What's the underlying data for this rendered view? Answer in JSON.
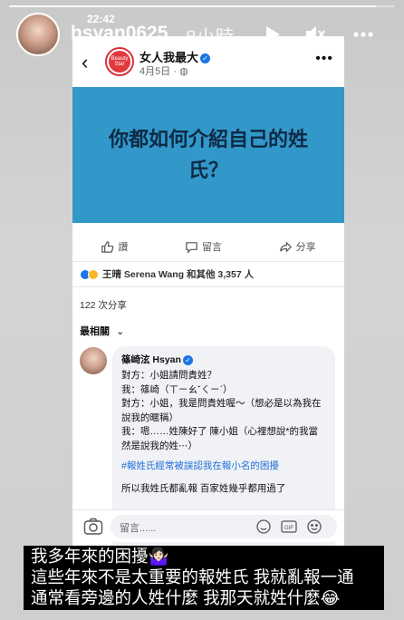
{
  "story": {
    "username": "hsyan0625",
    "time": "8小時",
    "progress": 0.95,
    "icons": [
      "play-icon",
      "mute-icon",
      "more-icon"
    ]
  },
  "phone_status": {
    "time": "22:42"
  },
  "post": {
    "page_name": "女人我最大",
    "page_logo_text": "Beauty Star",
    "date": "4月5日 · ",
    "banner_text": "你都如何介紹自己的姓氏？",
    "actions": {
      "like": "讚",
      "comment": "留言",
      "share": "分享"
    },
    "reactions_text": "王晴 Serena Wang 和其他 3,357 人",
    "shares_text": "122 次分享",
    "sort_label": "最相關",
    "comment": {
      "author": "篠崎泫 Hsyan",
      "lines": [
        "對方：小姐請問貴姓？",
        "我：篠崎（ㄒㄧㄠˇㄑㄧˊ）",
        "對方：小姐，我是問貴姓喔～（想必是以為我在說我的暱稱）",
        "我：嗯……姓陳好了 陳小姐（心裡想說*的我當然是說我的姓⋯）"
      ],
      "tag": "#報姓氏經常被誤認我在報小名的困擾",
      "extra": "所以我姓氏都亂報 百家姓幾乎都用過了"
    },
    "composer_placeholder": "留言......"
  },
  "caption": {
    "line1": "我多年來的困擾🤷🏻‍♀️",
    "line2": "這些年來不是太重要的報姓氏 我就亂報一通",
    "line3": "通常看旁邊的人姓什麼 我那天就姓什麼😂"
  }
}
